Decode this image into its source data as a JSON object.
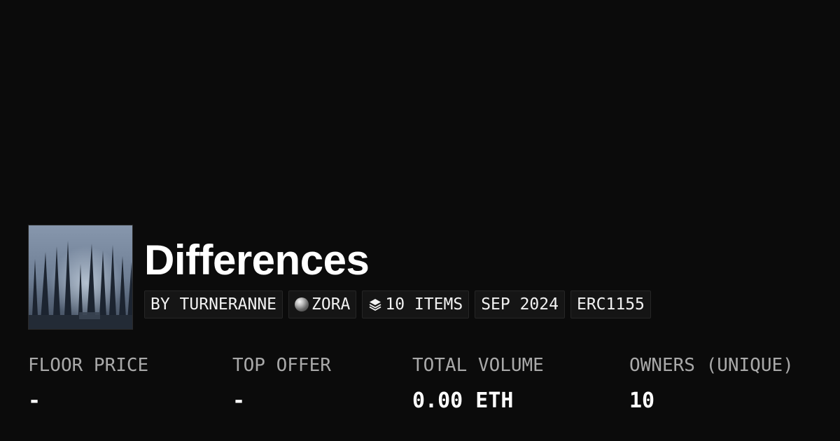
{
  "collection": {
    "name": "Differences",
    "image_icon": "forest-thumbnail"
  },
  "tags": {
    "creator": "BY TURNERANNE",
    "chain": "ZORA",
    "chain_icon": "zora-orb-icon",
    "items": "10 ITEMS",
    "items_icon": "layers-icon",
    "date": "SEP 2024",
    "standard": "ERC1155"
  },
  "stats": {
    "floor_price": {
      "label": "FLOOR PRICE",
      "value": "-"
    },
    "top_offer": {
      "label": "TOP OFFER",
      "value": "-"
    },
    "total_volume": {
      "label": "TOTAL VOLUME",
      "value": "0.00 ETH"
    },
    "owners": {
      "label": "OWNERS (UNIQUE)",
      "value": "10"
    }
  },
  "colors": {
    "background": "#0b0b0b",
    "tag_background": "#151515",
    "label_gray": "#a9a9a9",
    "text": "#ffffff"
  }
}
